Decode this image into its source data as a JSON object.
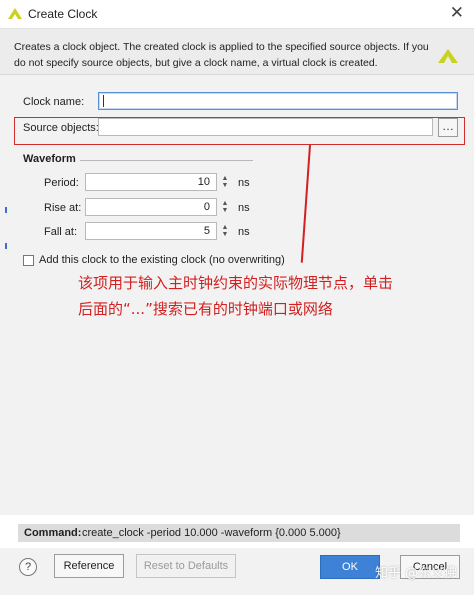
{
  "window": {
    "title": "Create Clock",
    "close_glyph": "✕"
  },
  "header": {
    "description": "Creates a clock object. The created clock is applied to the specified source objects. If you do not specify source objects, but give a clock name, a virtual clock is created."
  },
  "form": {
    "clock_name": {
      "label": "Clock name:",
      "value": ""
    },
    "source_objects": {
      "label": "Source objects:",
      "value": "",
      "browse_label": "…"
    }
  },
  "waveform": {
    "title": "Waveform",
    "period": {
      "label": "Period:",
      "value": "10",
      "unit": "ns"
    },
    "rise_at": {
      "label": "Rise at:",
      "value": "0",
      "unit": "ns"
    },
    "fall_at": {
      "label": "Fall at:",
      "value": "5",
      "unit": "ns"
    }
  },
  "add_clock_checkbox": {
    "label": "Add this clock to the existing clock (no overwriting)",
    "checked": false
  },
  "annotation": {
    "text": "该项用于输入主时钟约束的实际物理节点，单击后面的“...”搜索已有的时钟端口或网络",
    "color": "#d22020"
  },
  "command": {
    "label": "Command:",
    "text": "create_clock -period 10.000 -waveform {0.000 5.000}"
  },
  "footer": {
    "help_glyph": "?",
    "reference_label": "Reference",
    "reset_label": "Reset to Defaults",
    "ok_label": "OK",
    "cancel_label": "Cancel"
  },
  "watermark": "知乎 @东义佛",
  "colors": {
    "accent": "#3d82d6",
    "highlight": "#d22d2d",
    "logo": "#c9d21e"
  }
}
